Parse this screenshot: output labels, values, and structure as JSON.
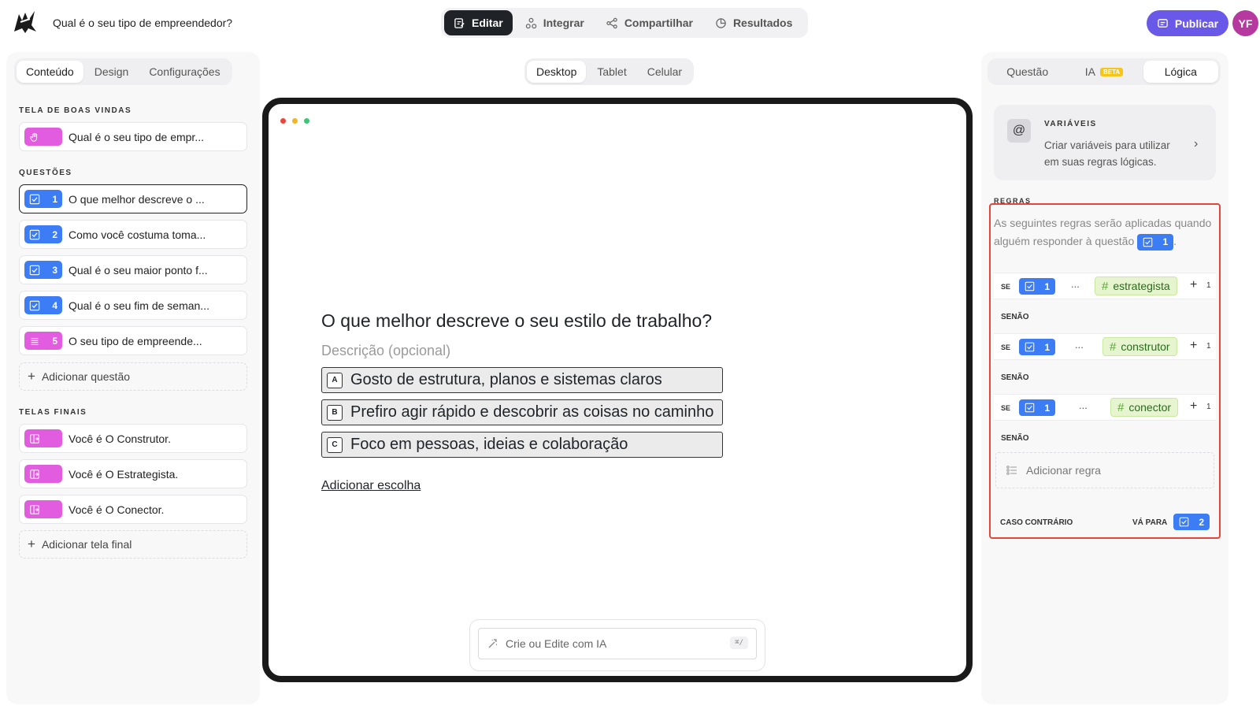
{
  "header": {
    "doc_title": "Qual é o seu tipo de empreendedor?",
    "tabs": [
      {
        "label": "Editar",
        "icon": "edit-icon"
      },
      {
        "label": "Integrar",
        "icon": "integrate-icon"
      },
      {
        "label": "Compartilhar",
        "icon": "share-icon"
      },
      {
        "label": "Resultados",
        "icon": "results-icon"
      }
    ],
    "publish_label": "Publicar",
    "avatar_initials": "YF",
    "colors": {
      "publish": "#6a58e8",
      "avatar": "#b5399f",
      "active_tab": "#1f2328"
    }
  },
  "left": {
    "tabs": [
      "Conteúdo",
      "Design",
      "Configurações"
    ],
    "welcome_label": "TELA DE BOAS VINDAS",
    "welcome_item": "Qual é o seu tipo de empr...",
    "questions_label": "QUESTÕES",
    "questions": [
      {
        "num": "1",
        "text": "O que melhor descreve o ..."
      },
      {
        "num": "2",
        "text": "Como você costuma toma..."
      },
      {
        "num": "3",
        "text": "Qual é o seu maior ponto f..."
      },
      {
        "num": "4",
        "text": "Qual é o seu fim de seman..."
      },
      {
        "num": "5",
        "text": "O seu tipo de empreende..."
      }
    ],
    "add_question": "Adicionar questão",
    "endings_label": "TELAS FINAIS",
    "endings": [
      "Você é O Construtor.",
      "Você é O Estrategista.",
      "Você é O Conector."
    ],
    "add_ending": "Adicionar tela final"
  },
  "center": {
    "devices": [
      "Desktop",
      "Tablet",
      "Celular"
    ],
    "question_title": "O que melhor descreve o seu estilo de trabalho?",
    "description_placeholder": "Descrição (opcional)",
    "choices": [
      {
        "key": "A",
        "text": "Gosto de estrutura, planos e sistemas claros"
      },
      {
        "key": "B",
        "text": "Prefiro agir rápido e descobrir as coisas no caminho"
      },
      {
        "key": "C",
        "text": "Foco em pessoas, ideias e colaboração"
      }
    ],
    "add_choice": "Adicionar escolha",
    "ai_placeholder": "Crie ou Edite com IA",
    "ai_shortcut": "⌘/"
  },
  "right": {
    "tabs": [
      "Questão",
      "IA",
      "Lógica"
    ],
    "beta": "BETA",
    "variables_title": "VARIÁVEIS",
    "variables_desc": "Criar variáveis para utilizar em suas regras lógicas.",
    "rules_label": "REGRAS",
    "rules_intro_pre": "As seguintes regras serão aplicadas quando alguém responder à questão",
    "rules_intro_num": "1",
    "rules_intro_post": ".",
    "rules": [
      {
        "se": "SE",
        "num": "1",
        "ellipsis": "...",
        "tag": "estrategista",
        "plus_n": "1"
      },
      {
        "se": "SE",
        "num": "1",
        "ellipsis": "...",
        "tag": "construtor",
        "plus_n": "1"
      },
      {
        "se": "SE",
        "num": "1",
        "ellipsis": "...",
        "tag": "conector",
        "plus_n": "1"
      }
    ],
    "senao": "SENÃO",
    "add_rule": "Adicionar regra",
    "otherwise": "CASO CONTRÁRIO",
    "goto": "VÁ PARA",
    "goto_num": "2"
  }
}
